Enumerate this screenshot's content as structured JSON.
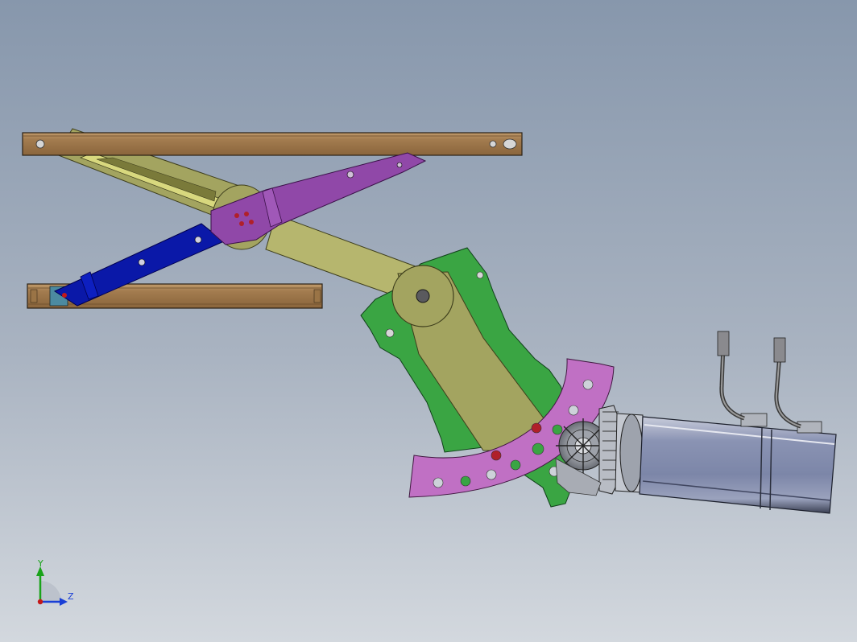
{
  "triad": {
    "y_label": "Y",
    "z_label": "Z",
    "y_color": "#1aa31a",
    "z_color": "#1a3fd6",
    "origin_color": "#c41818"
  },
  "colors": {
    "background_top": "#8797ac",
    "background_bottom": "#d3d8de",
    "rail": "#a37c4f",
    "olive_arm": "#a3a460",
    "lower_olive_arm": "#b6b66e",
    "purple_arm": "#9048a8",
    "blue_arm": "#0a18a8",
    "green_plate": "#3aa543",
    "sector_gear": "#c070c4",
    "motor_body": "#7c86a8",
    "gear_metal": "#b0b4bc",
    "hole_red": "#b0202a",
    "cable": "#5a5a5a"
  },
  "icons": {
    "viewport": "cad-3d-view-icon",
    "triad": "coordinate-triad-icon"
  }
}
